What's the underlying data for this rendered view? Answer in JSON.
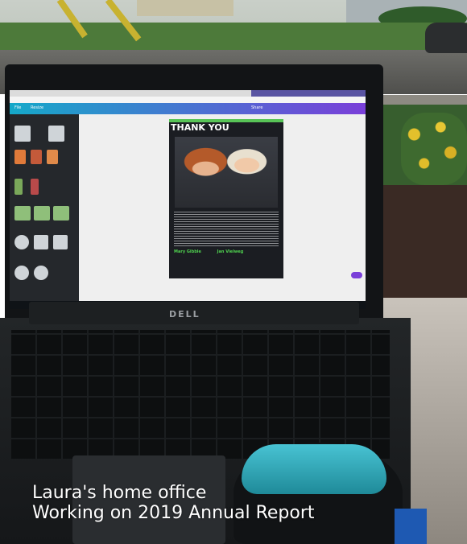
{
  "photo": {
    "description_icon": "photo-image",
    "screen": {
      "laptop_brand": "DELL",
      "document_heading": "THANK YOU",
      "names": [
        "Mary Gibble",
        "Jan Vielweg"
      ]
    },
    "caption": {
      "line1": "Laura's home office",
      "line2": "Working on 2019 Annual Report"
    }
  }
}
